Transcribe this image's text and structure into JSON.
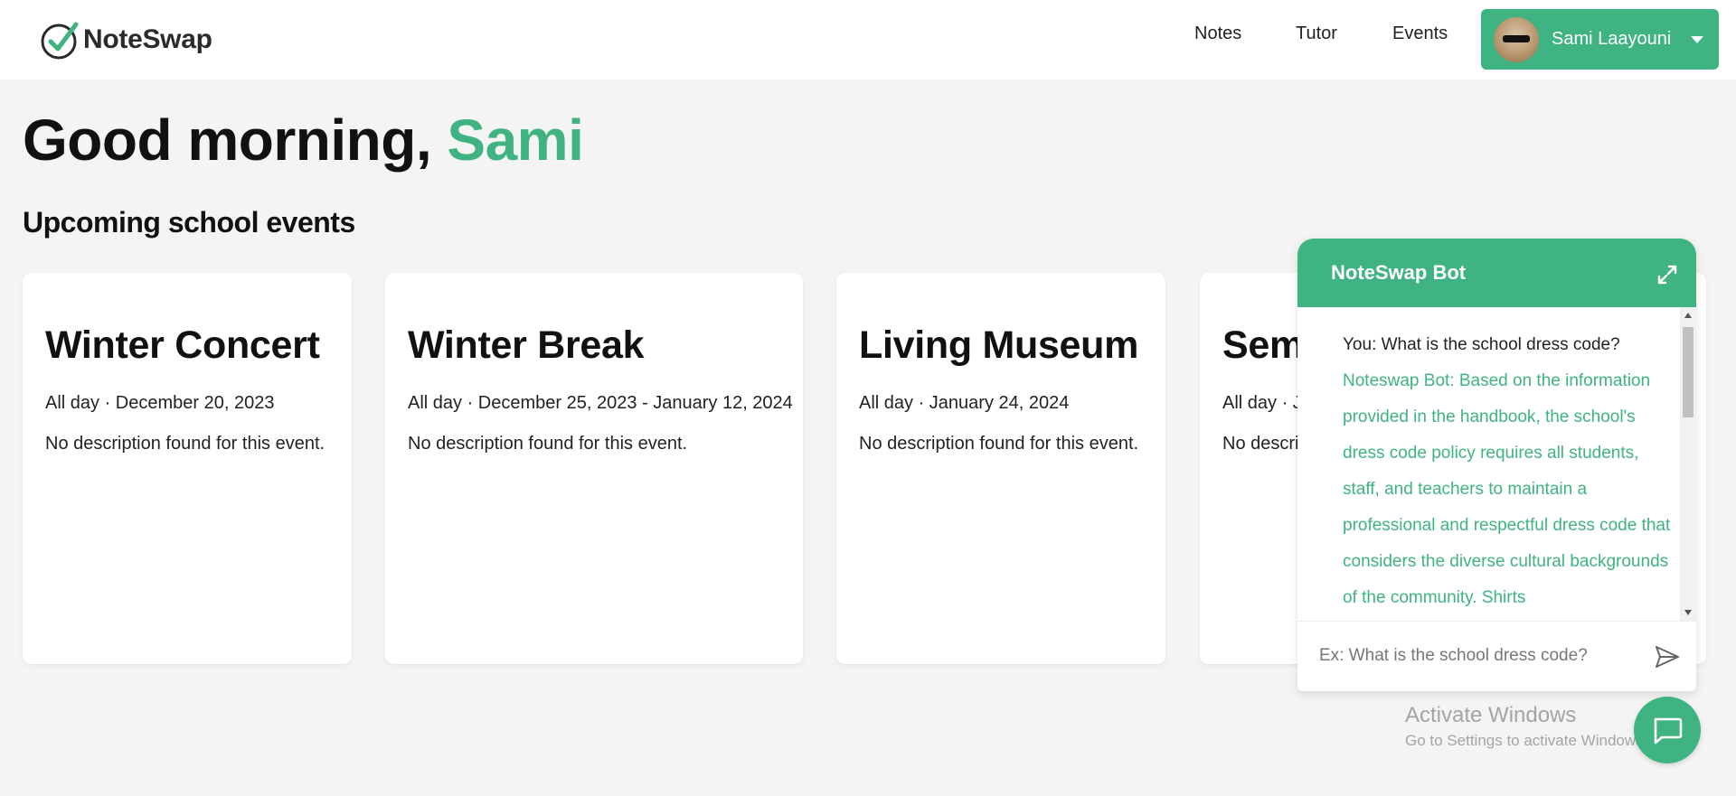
{
  "app": {
    "name": "NoteSwap",
    "accent": "#3fb381"
  },
  "nav": {
    "links": [
      {
        "label": "Notes"
      },
      {
        "label": "Tutor"
      },
      {
        "label": "Events"
      }
    ],
    "user": {
      "name": "Sami Laayouni"
    }
  },
  "greeting": {
    "prefix": "Good morning, ",
    "name": "Sami"
  },
  "events_section": {
    "title": "Upcoming school events"
  },
  "events": [
    {
      "title": "Winter Concert",
      "date": "All day · December 20, 2023",
      "description": "No description found for this event."
    },
    {
      "title": "Winter Break",
      "date": "All day · December 25, 2023 - January 12, 2024",
      "description": "No description found for this event."
    },
    {
      "title": "Living Museum",
      "date": "All day · January 24, 2024",
      "description": "No description found for this event."
    },
    {
      "title": "Sem",
      "date": "All day · J",
      "description": "No descri"
    }
  ],
  "chat": {
    "title": "NoteSwap Bot",
    "messages": [
      {
        "sender": "user",
        "text": "You: What is the school dress code?"
      },
      {
        "sender": "bot",
        "text": "Noteswap Bot: Based on the information provided in the handbook, the school's dress code policy requires all students, staff, and teachers to maintain a professional and respectful dress code that considers the diverse cultural backgrounds of the community. Shirts"
      }
    ],
    "input_placeholder": "Ex: What is the school dress code?"
  },
  "watermark": {
    "title": "Activate Windows",
    "subtitle": "Go to Settings to activate Windows."
  },
  "icons": {
    "logo": "check-circle-icon",
    "caret": "caret-down-icon",
    "expand": "expand-icon",
    "send": "send-icon",
    "chat": "chat-bubble-icon"
  }
}
